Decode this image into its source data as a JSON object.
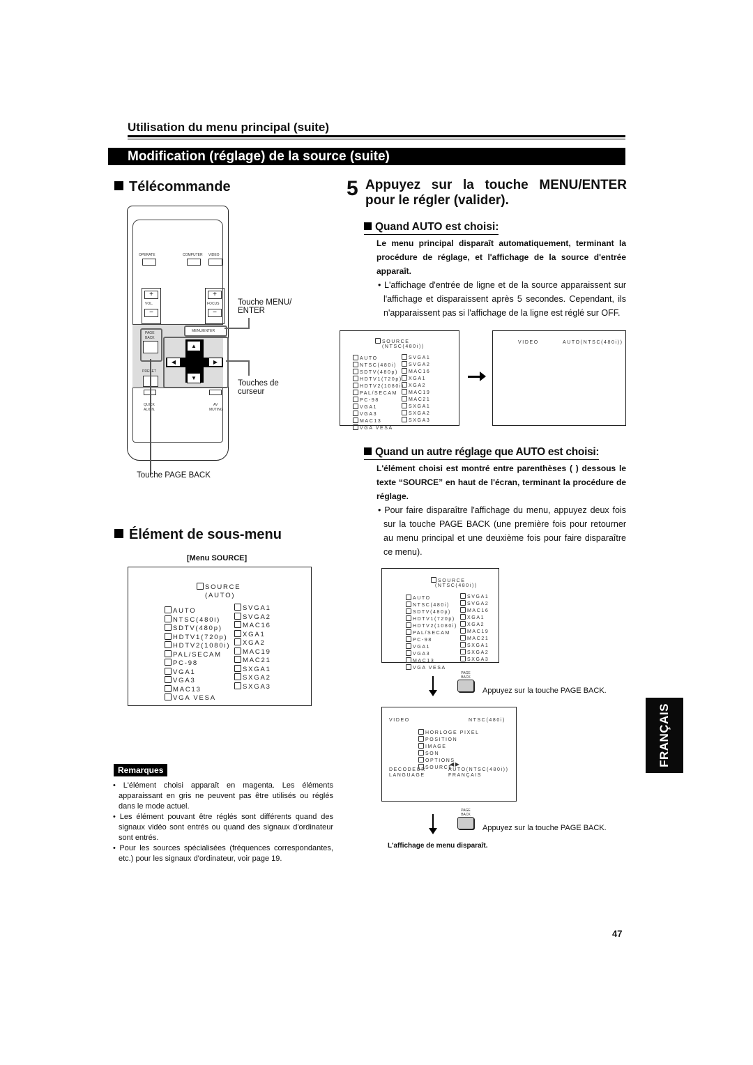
{
  "header": {
    "subtitle": "Utilisation du menu principal (suite)",
    "section_bar": "Modification (réglage) de la source (suite)"
  },
  "left": {
    "telecommande_heading": "Télécommande",
    "remote": {
      "operate": "OPERATE",
      "computer": "COMPUTER",
      "video": "VIDEO",
      "vol": "VOL.",
      "focus": "FOCUS",
      "plus": "+",
      "minus": "−",
      "menu_enter": "MENU/ENTER",
      "page": "PAGE",
      "back": "BACK",
      "preset": "PRESET",
      "quick": "QUICK",
      "align": "ALIGN.",
      "av": "AV",
      "muting": "MUTING",
      "up": "▲",
      "down": "▼",
      "left": "◀",
      "right": "▶"
    },
    "callouts": {
      "menu_enter_1": "Touche MENU/",
      "menu_enter_2": "ENTER",
      "cursor_1": "Touches de",
      "cursor_2": "curseur",
      "page_back": "Touche PAGE BACK"
    },
    "submenu_heading": "Élément de sous-menu",
    "menu_source_caption": "[Menu SOURCE]",
    "menu_source_screen": {
      "title": "SOURCE",
      "current": "(AUTO)",
      "col1": [
        "AUTO",
        "NTSC(480i)",
        "SDTV(480p)",
        "HDTV1(720p)",
        "HDTV2(1080i)",
        "PAL/SECAM",
        "PC-98",
        "VGA1",
        "VGA3",
        "MAC13",
        "VGA VESA"
      ],
      "col2": [
        "SVGA1",
        "SVGA2",
        "MAC16",
        "XGA1",
        "XGA2",
        "MAC19",
        "MAC21",
        "SXGA1",
        "SXGA2",
        "SXGA3"
      ]
    },
    "remarques_label": "Remarques",
    "remarques": [
      "L'élément choisi apparaît en magenta. Les éléments apparaissant en gris ne peuvent pas être utilisés ou réglés dans le mode actuel.",
      "Les élément pouvant être réglés sont différents quand des signaux vidéo sont entrés ou quand des signaux d'ordinateur sont entrés.",
      "Pour les sources spécialisées (fréquences correspondantes, etc.) pour les signaux d'ordinateur, voir page 19."
    ]
  },
  "right": {
    "step_number": "5",
    "step_text": "Appuyez sur la touche MENU/ENTER pour le régler (valider).",
    "auto": {
      "heading": "Quand AUTO est choisi:",
      "bold": "Le menu principal disparaît automatiquement, terminant la procédure de réglage, et l'affichage de la source d'entrée apparaît.",
      "bullet": "L'affichage d'entrée de ligne et de la source apparaissent sur l'affichage et disparaissent après 5 secondes. Cependant, ils n'apparaissent pas si l'affichage de la ligne est réglé sur OFF.",
      "screen_before": {
        "title": "SOURCE",
        "current": "(NTSC(480i))"
      },
      "screen_after": {
        "line": "VIDEO",
        "source": "AUTO(NTSC(480i))"
      }
    },
    "other": {
      "heading": "Quand un autre réglage que AUTO est choisi:",
      "bold": "L'élément choisi est montré entre parenthèses (   ) dessous le texte “SOURCE” en haut de l'écran, terminant la procédure de réglage.",
      "bullet": "Pour faire disparaître l'affichage du menu, appuyez deux fois sur la touche PAGE BACK (une première fois pour retourner au menu principal et une deuxième fois pour faire disparaître ce menu).",
      "screen_source": {
        "title": "SOURCE",
        "current": "(NTSC(480i))"
      },
      "page_back_instruction": "Appuyez sur la touche PAGE BACK.",
      "main_menu_screen": {
        "line": "VIDEO",
        "signal": "NTSC(480i)",
        "items": [
          "HORLOGE PIXEL",
          "POSITION",
          "IMAGE",
          "SON",
          "OPTIONS",
          "SOURCE"
        ],
        "decoder_label": "DECODEUR",
        "decoder_value": "AUTO(NTSC(480i))",
        "language_label": "LANGUAGE",
        "language_value": "FRANÇAIS",
        "lr_arrows": "◀▶"
      },
      "page_back_instruction_2": "Appuyez sur la touche PAGE BACK.",
      "menu_disappears": "L'affichage de menu disparaît."
    }
  },
  "lang_tab": "FRANÇAIS",
  "page_number": "47"
}
